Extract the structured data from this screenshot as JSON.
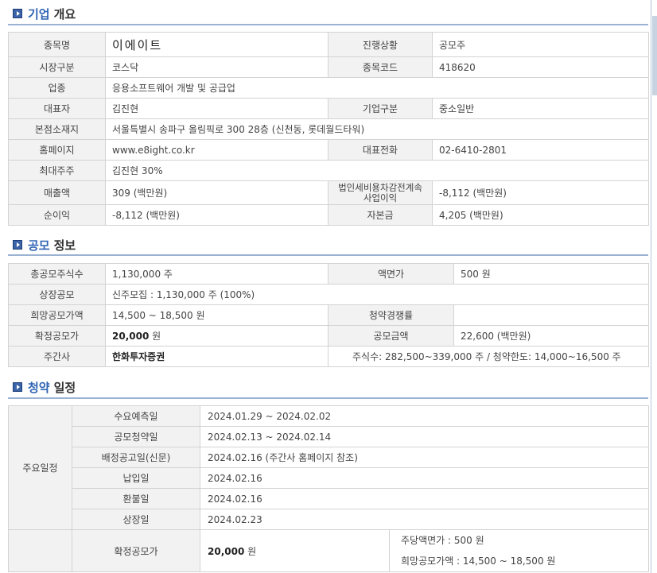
{
  "overview": {
    "title_main": "기업",
    "title_sub": "개요",
    "rows": {
      "name_label": "종목명",
      "name_value": "이에이트",
      "status_label": "진행상황",
      "status_value": "공모주",
      "market_label": "시장구분",
      "market_value": "코스닥",
      "code_label": "종목코드",
      "code_value": "418620",
      "industry_label": "업종",
      "industry_value": "응용소프트웨어 개발 및 공급업",
      "ceo_label": "대표자",
      "ceo_value": "김진현",
      "corp_type_label": "기업구분",
      "corp_type_value": "중소일반",
      "hq_label": "본점소재지",
      "hq_value": "서울특별시 송파구 올림픽로 300 28층 (신천동, 롯데월드타워)",
      "homepage_label": "홈페이지",
      "homepage_value": "www.e8ight.co.kr",
      "phone_label": "대표전화",
      "phone_value": "02-6410-2801",
      "holder_label": "최대주주",
      "holder_value": "김진현 30%",
      "sales_label": "매출액",
      "sales_value": "309 (백만원)",
      "pretax_label": "법인세비용차감전계속사업이익",
      "pretax_value": "-8,112 (백만원)",
      "net_label": "순이익",
      "net_value": "-8,112 (백만원)",
      "capital_label": "자본금",
      "capital_value": "4,205 (백만원)"
    }
  },
  "offering": {
    "title_main": "공모",
    "title_sub": "정보",
    "rows": {
      "total_label": "총공모주식수",
      "total_value": "1,130,000 주",
      "par_label": "액면가",
      "par_value": "500 원",
      "listing_label": "상장공모",
      "listing_value": "신주모집 : 1,130,000 주 (100%)",
      "hope_label": "희망공모가액",
      "hope_value": "14,500 ~ 18,500 원",
      "comp_label": "청약경쟁률",
      "comp_value": "",
      "fixed_label": "확정공모가",
      "fixed_value": "20,000",
      "fixed_unit": " 원",
      "amount_label": "공모금액",
      "amount_value": "22,600 (백만원)",
      "under_label": "주간사",
      "under_value": "한화투자증권",
      "under_detail": "주식수: 282,500~339,000 주    /    청약한도: 14,000~16,500 주"
    }
  },
  "schedule": {
    "title_main": "청약",
    "title_sub": "일정",
    "group_label": "주요일정",
    "items": [
      {
        "label": "수요예측일",
        "value": "2024.01.29   ~   2024.02.02"
      },
      {
        "label": "공모청약일",
        "value": "2024.02.13   ~   2024.02.14"
      },
      {
        "label": "배정공고일(신문)",
        "value": "2024.02.16 (주간사 홈페이지 참조)"
      },
      {
        "label": "납입일",
        "value": "2024.02.16"
      },
      {
        "label": "환불일",
        "value": "2024.02.16"
      },
      {
        "label": "상장일",
        "value": "2024.02.23"
      }
    ],
    "fixed_label": "확정공모가",
    "fixed_value": "20,000",
    "fixed_unit": " 원",
    "par_line": "주당액면가 :   500 원",
    "hope_line": "희망공모가액 :   14,500 ~ 18,500 원"
  }
}
